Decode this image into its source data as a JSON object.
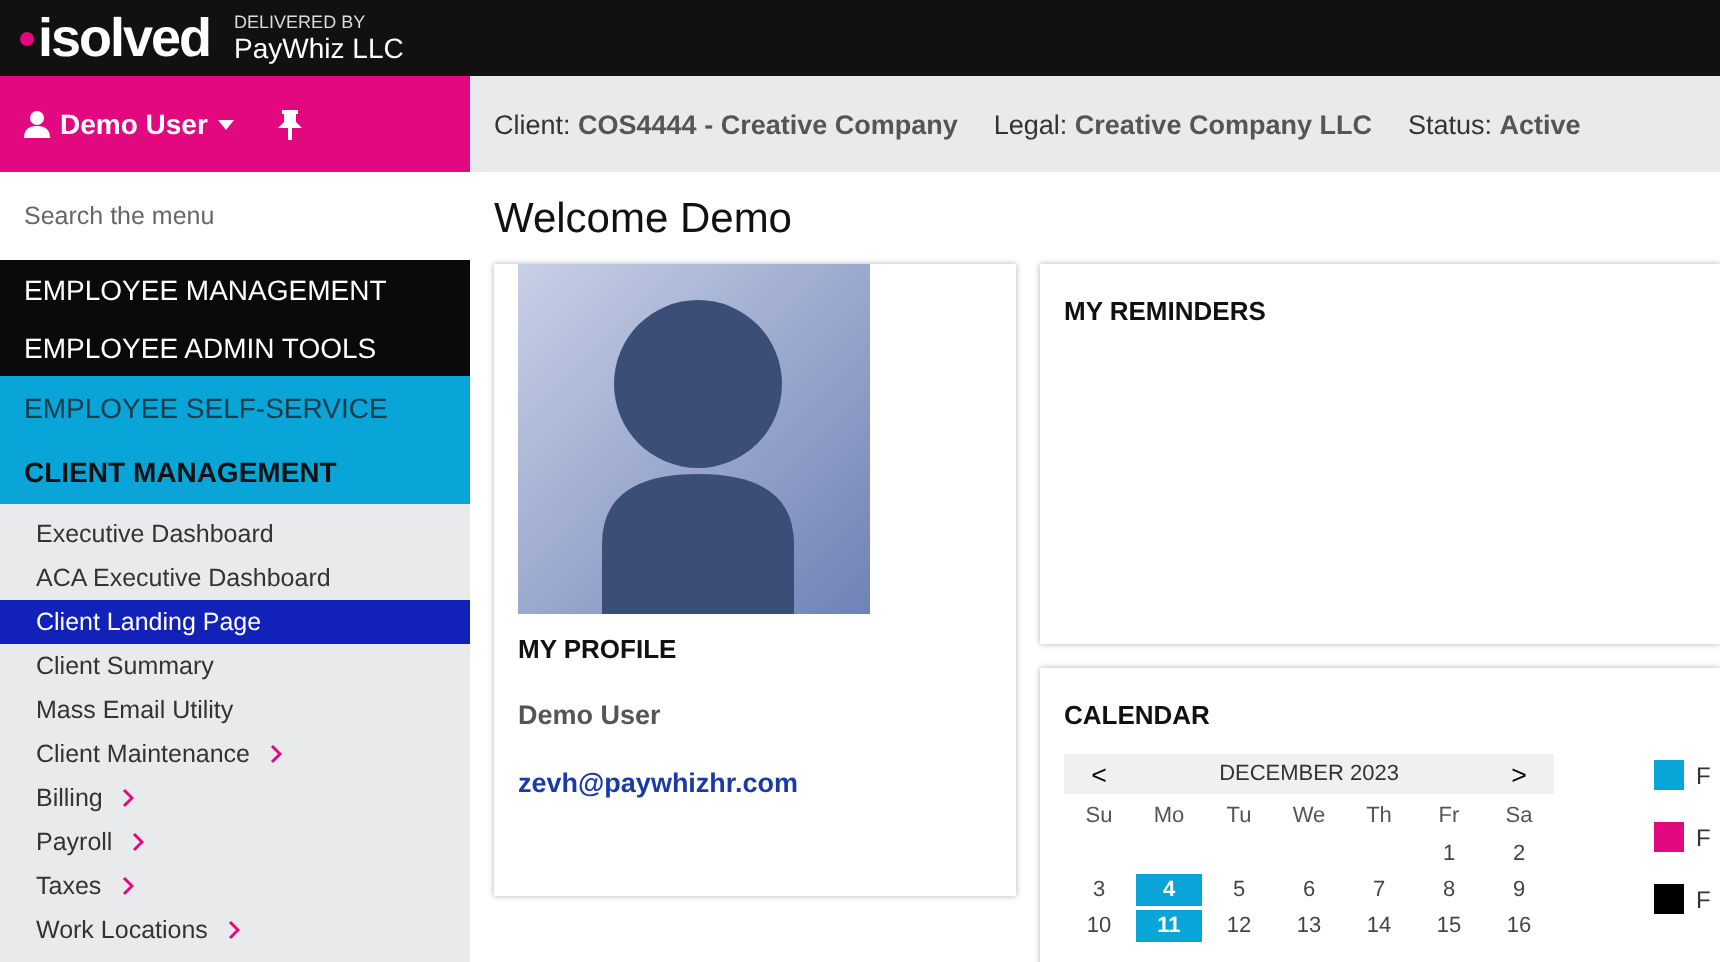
{
  "header": {
    "logo": "isolved",
    "delivered_by": "DELIVERED BY",
    "provider": "PayWhiz LLC"
  },
  "user_menu": {
    "name": "Demo User"
  },
  "info_bar": [
    {
      "label": "Client:",
      "value": "COS4444 - Creative Company"
    },
    {
      "label": "Legal:",
      "value": "Creative Company LLC"
    },
    {
      "label": "Status:",
      "value": "Active"
    }
  ],
  "sidebar": {
    "search": {
      "placeholder": "Search the menu"
    },
    "sections": [
      {
        "label": "EMPLOYEE MANAGEMENT",
        "kind": "dark"
      },
      {
        "label": "EMPLOYEE ADMIN TOOLS",
        "kind": "dark"
      },
      {
        "label": "EMPLOYEE SELF-SERVICE",
        "kind": "accent"
      },
      {
        "label": "CLIENT MANAGEMENT",
        "kind": "accent-bold"
      }
    ],
    "items": [
      {
        "label": "Executive Dashboard",
        "submenu": false,
        "selected": false
      },
      {
        "label": "ACA Executive Dashboard",
        "submenu": false,
        "selected": false
      },
      {
        "label": "Client Landing Page",
        "submenu": false,
        "selected": true
      },
      {
        "label": "Client Summary",
        "submenu": false,
        "selected": false
      },
      {
        "label": "Mass Email Utility",
        "submenu": false,
        "selected": false
      },
      {
        "label": "Client Maintenance",
        "submenu": true,
        "selected": false
      },
      {
        "label": "Billing",
        "submenu": true,
        "selected": false
      },
      {
        "label": "Payroll",
        "submenu": true,
        "selected": false
      },
      {
        "label": "Taxes",
        "submenu": true,
        "selected": false
      },
      {
        "label": "Work Locations",
        "submenu": true,
        "selected": false
      }
    ]
  },
  "page_title": "Welcome Demo",
  "profile": {
    "title": "MY PROFILE",
    "name": "Demo User",
    "email": "zevh@paywhizhr.com"
  },
  "reminders": {
    "title": "MY REMINDERS"
  },
  "calendar": {
    "title": "CALENDAR",
    "prev": "<",
    "month": "DECEMBER 2023",
    "next": ">",
    "weekdays": [
      "Su",
      "Mo",
      "Tu",
      "We",
      "Th",
      "Fr",
      "Sa"
    ],
    "weeks": [
      [
        {
          "day": "1",
          "selected": false
        },
        {
          "day": "2",
          "selected": false
        }
      ],
      [
        {
          "day": "3",
          "selected": false
        },
        {
          "day": "4",
          "selected": true
        },
        {
          "day": "5",
          "selected": false
        },
        {
          "day": "6",
          "selected": false
        },
        {
          "day": "7",
          "selected": false
        },
        {
          "day": "8",
          "selected": false
        },
        {
          "day": "9",
          "selected": false
        }
      ],
      [
        {
          "day": "10",
          "selected": false
        },
        {
          "day": "11",
          "selected": true
        },
        {
          "day": "12",
          "selected": false
        },
        {
          "day": "13",
          "selected": false
        },
        {
          "day": "14",
          "selected": false
        },
        {
          "day": "15",
          "selected": false
        },
        {
          "day": "16",
          "selected": false
        }
      ]
    ],
    "legend": [
      {
        "label": "F",
        "color": "#0aa5d8"
      },
      {
        "label": "F",
        "color": "#e2087f"
      },
      {
        "label": "F",
        "color": "#000000"
      }
    ]
  }
}
